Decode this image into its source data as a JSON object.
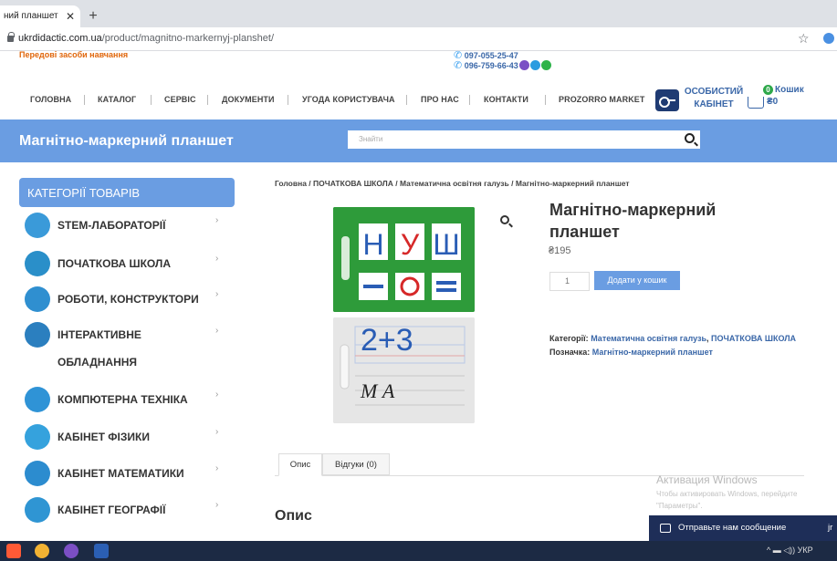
{
  "browser": {
    "tab_title": "ний планшет",
    "tab_close": "✕",
    "new_tab": "+",
    "url_host": "ukrdidactic.com.ua",
    "url_path": "/product/magnitno-markernyj-planshet/"
  },
  "top": {
    "tagline": "Передові засоби навчання",
    "phone1": "097-055-25-47",
    "phone2": "096-759-66-43"
  },
  "nav": {
    "items": [
      "ГОЛОВНА",
      "КАТАЛОГ",
      "СЕРВІС",
      "ДОКУМЕНТИ",
      "УГОДА КОРИСТУВАЧА",
      "ПРО НАС",
      "КОНТАКТИ",
      "PROZORRO MARKET"
    ],
    "account_line1": "ОСОБИСТИЙ",
    "account_line2": "КАБІНЕТ",
    "cart_count": "0",
    "cart_label": "Кошик",
    "cart_total": "₴0"
  },
  "header": {
    "title": "Магнітно-маркерний планшет",
    "search_placeholder": "Знайти"
  },
  "sidebar": {
    "heading": "КАТЕГОРІЇ ТОВАРІВ",
    "items": [
      {
        "label": "STEM-ЛАБОРАТОРІЇ",
        "color": "#3a9ad9"
      },
      {
        "label": "ПОЧАТКОВА ШКОЛА",
        "color": "#2a8fc9"
      },
      {
        "label": "РОБОТИ, КОНСТРУКТОРИ",
        "color": "#2f8fd0"
      },
      {
        "label": "ІНТЕРАКТИВНЕ",
        "label2": "ОБЛАДНАННЯ",
        "color": "#2b7fbf"
      },
      {
        "label": "КОМПЮТЕРНА ТЕХНІКА",
        "color": "#2f93d6"
      },
      {
        "label": "КАБІНЕТ ФІЗИКИ",
        "color": "#35a2dd"
      },
      {
        "label": "КАБІНЕТ МАТЕМАТИКИ",
        "color": "#2c8ccf"
      },
      {
        "label": "КАБІНЕТ ГЕОГРАФІЇ",
        "color": "#2f95d3"
      }
    ],
    "chevron": "›"
  },
  "product": {
    "breadcrumb": "Головна / ПОЧАТКОВА ШКОЛА / Математична освітня галузь / Магнітно-маркерний планшет",
    "title": "Магнітно-маркерний планшет",
    "price": "₴195",
    "quantity": "1",
    "add_to_cart": "Додати у кошик",
    "categories_label": "Категорії:",
    "category1": "Математична освітня галузь",
    "category2": "ПОЧАТКОВА ШКОЛА",
    "tag_label": "Позначка:",
    "tag": "Магнітно-маркерний планшет",
    "image_letters": [
      "Н",
      "У",
      "Ш"
    ],
    "image_math": "2+3",
    "image_script": "М А"
  },
  "tabs": {
    "description": "Опис",
    "reviews": "Відгуки (0)"
  },
  "description_heading": "Опис",
  "watermark": {
    "line1": "Активация Windows",
    "line2": "Чтобы активировать Windows, перейдите",
    "line3": "\"Параметры\"."
  },
  "chat": {
    "label": "Отправьте нам сообщение",
    "extra": "jr"
  },
  "taskbar": {
    "tray_text": "УКР"
  },
  "colors": {
    "accent": "#6a9de2",
    "link": "#3a67a8",
    "tagline": "#e0660b",
    "chat": "#1e2e58"
  }
}
